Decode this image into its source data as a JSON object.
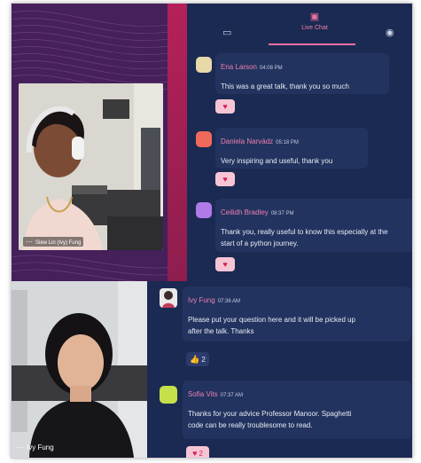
{
  "tabs": {
    "live_chat": "Live Chat"
  },
  "speaker": {
    "name_tag": "Siew Lin (Ivy) Fung"
  },
  "ivy_video": {
    "name": "Ivy Fung"
  },
  "messages": [
    {
      "name": "Ena Larson",
      "time": "04:08 PM",
      "text": "This was a great talk, thank you so much",
      "avatar_color": "#e7d9a8",
      "reaction": "♥",
      "count": ""
    },
    {
      "name": "Daniela Narvádz",
      "time": "05:18 PM",
      "text": "Very inspiring and useful, thank you",
      "avatar_color": "#ef6a5a",
      "reaction": "♥",
      "count": ""
    },
    {
      "name": "Ceilidh Bradley",
      "time": "08:37 PM",
      "text_line1": "Thank you, really useful to know this especially at the",
      "text_line2": "start of a python journey.",
      "avatar_color": "#b07ae8",
      "reaction": "♥",
      "count": ""
    }
  ],
  "bottom_messages": [
    {
      "name": "Ivy Fung",
      "time": "07:36 AM",
      "text_line1": "Please put your question here and it will be picked up",
      "text_line2": "after the talk. Thanks",
      "reaction": "👍",
      "count": "2"
    },
    {
      "name": "Sofia Vits",
      "time": "07:37 AM",
      "text_line1": "Thanks for your advice Professor Manoor. Spaghetti",
      "text_line2": "code can be really troublesome to read.",
      "avatar_color": "#c6e04a",
      "reaction": "♥",
      "count": "2"
    }
  ],
  "colors": {
    "chat_bg": "#1b2a52",
    "bubble_bg": "#22335f",
    "accent_pink": "#f06fa0",
    "stage_purple": "#45205a"
  },
  "icons": {
    "book": "book-icon",
    "chat": "chat-icon",
    "eye": "eye-icon",
    "heart": "heart-icon",
    "thumbs_up": "thumbs-up-icon"
  }
}
